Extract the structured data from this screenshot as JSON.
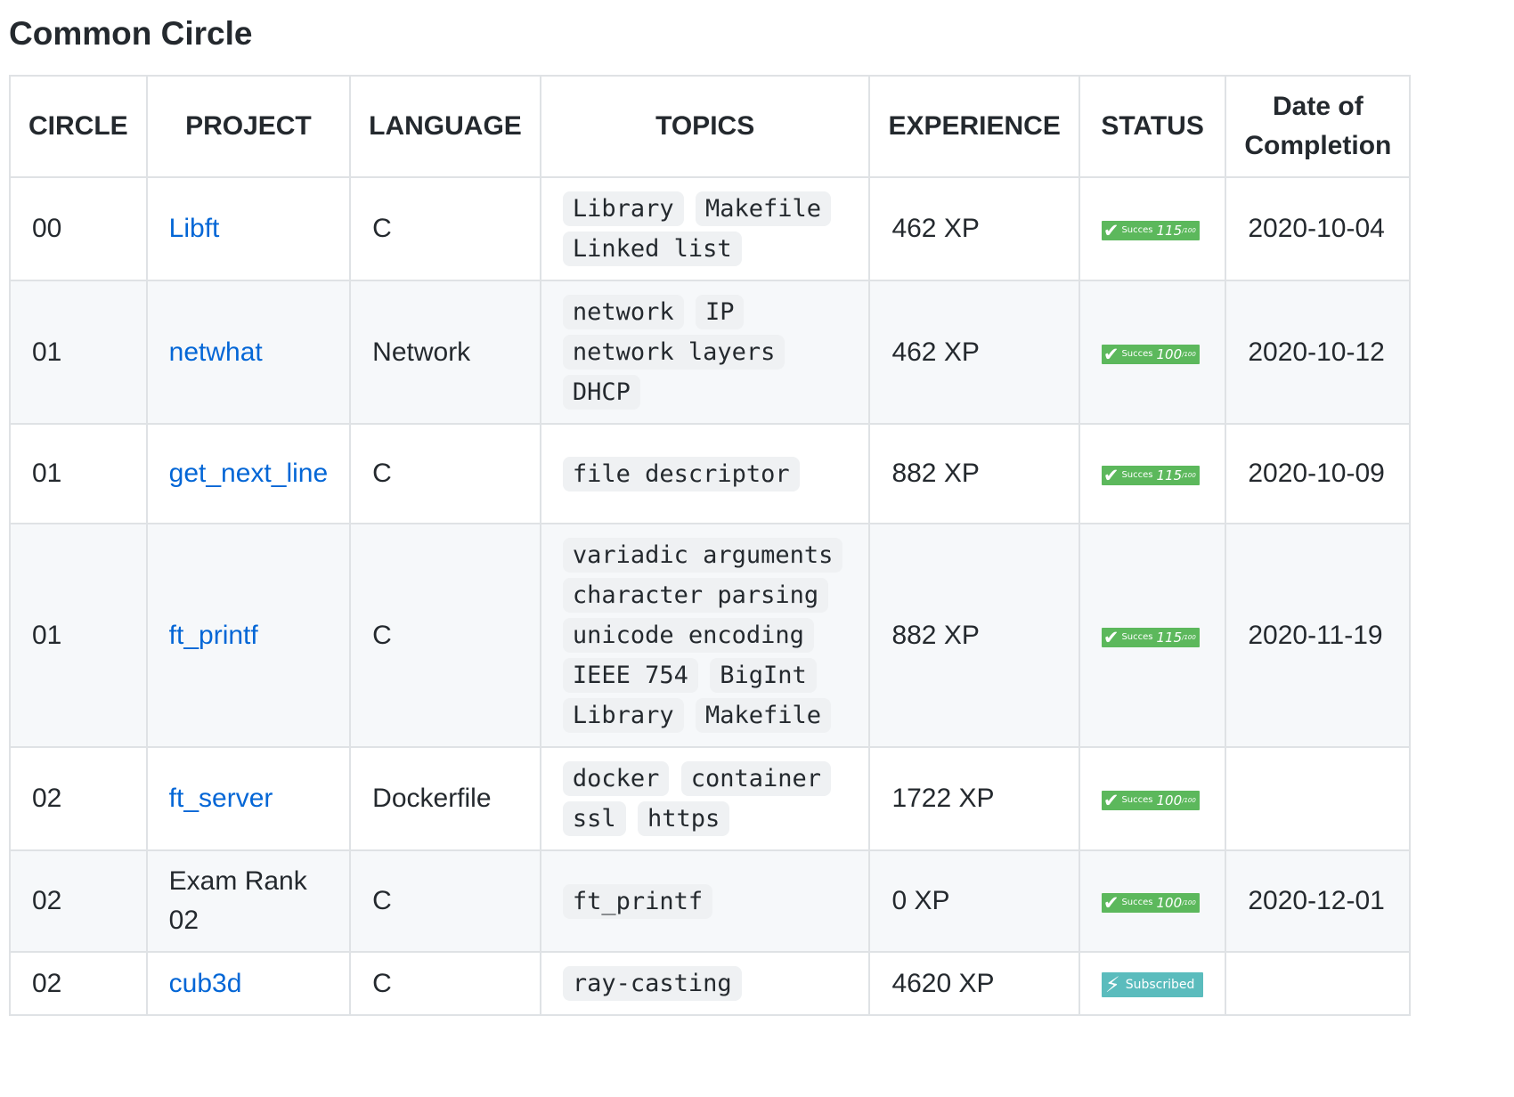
{
  "title": "Common Circle",
  "colors": {
    "link": "#0366d6",
    "success": "#5cb85c",
    "subscribed": "#5bbcbd"
  },
  "headers": {
    "circle": "CIRCLE",
    "project": "PROJECT",
    "language": "LANGUAGE",
    "topics": "TOPICS",
    "experience": "EXPERIENCE",
    "status": "STATUS",
    "date_line1": "Date of",
    "date_line2": "Completion"
  },
  "rows": [
    {
      "circle": "00",
      "project": "Libft",
      "project_is_link": true,
      "language": "C",
      "topics": [
        "Library",
        "Makefile",
        "Linked list"
      ],
      "experience": "462 XP",
      "status": {
        "kind": "success",
        "word": "Succes",
        "score": "115",
        "max": "/100"
      },
      "date": "2020-10-04"
    },
    {
      "circle": "01",
      "project": "netwhat",
      "project_is_link": true,
      "language": "Network",
      "topics": [
        "network",
        "IP",
        "network layers",
        "DHCP"
      ],
      "experience": "462 XP",
      "status": {
        "kind": "success",
        "word": "Succes",
        "score": "100",
        "max": "/100"
      },
      "date": "2020-10-12"
    },
    {
      "circle": "01",
      "project": "get_next_line",
      "project_is_link": true,
      "language": "C",
      "topics": [
        "file descriptor"
      ],
      "experience": "882 XP",
      "status": {
        "kind": "success",
        "word": "Succes",
        "score": "115",
        "max": "/100"
      },
      "date": "2020-10-09"
    },
    {
      "circle": "01",
      "project": "ft_printf",
      "project_is_link": true,
      "language": "C",
      "topics": [
        "variadic arguments",
        "character parsing",
        "unicode encoding",
        "IEEE 754",
        "BigInt",
        "Library",
        "Makefile"
      ],
      "experience": "882 XP",
      "status": {
        "kind": "success",
        "word": "Succes",
        "score": "115",
        "max": "/100"
      },
      "date": "2020-11-19"
    },
    {
      "circle": "02",
      "project": "ft_server",
      "project_is_link": true,
      "language": "Dockerfile",
      "topics": [
        "docker",
        "container",
        "ssl",
        "https"
      ],
      "experience": "1722 XP",
      "status": {
        "kind": "success",
        "word": "Succes",
        "score": "100",
        "max": "/100"
      },
      "date": ""
    },
    {
      "circle": "02",
      "project": "Exam Rank 02",
      "project_is_link": false,
      "language": "C",
      "topics": [
        "ft_printf"
      ],
      "experience": "0 XP",
      "status": {
        "kind": "success",
        "word": "Succes",
        "score": "100",
        "max": "/100"
      },
      "date": "2020-12-01"
    },
    {
      "circle": "02",
      "project": "cub3d",
      "project_is_link": true,
      "language": "C",
      "topics": [
        "ray-casting"
      ],
      "experience": "4620 XP",
      "status": {
        "kind": "subscribed",
        "word": "Subscribed"
      },
      "date": ""
    }
  ]
}
